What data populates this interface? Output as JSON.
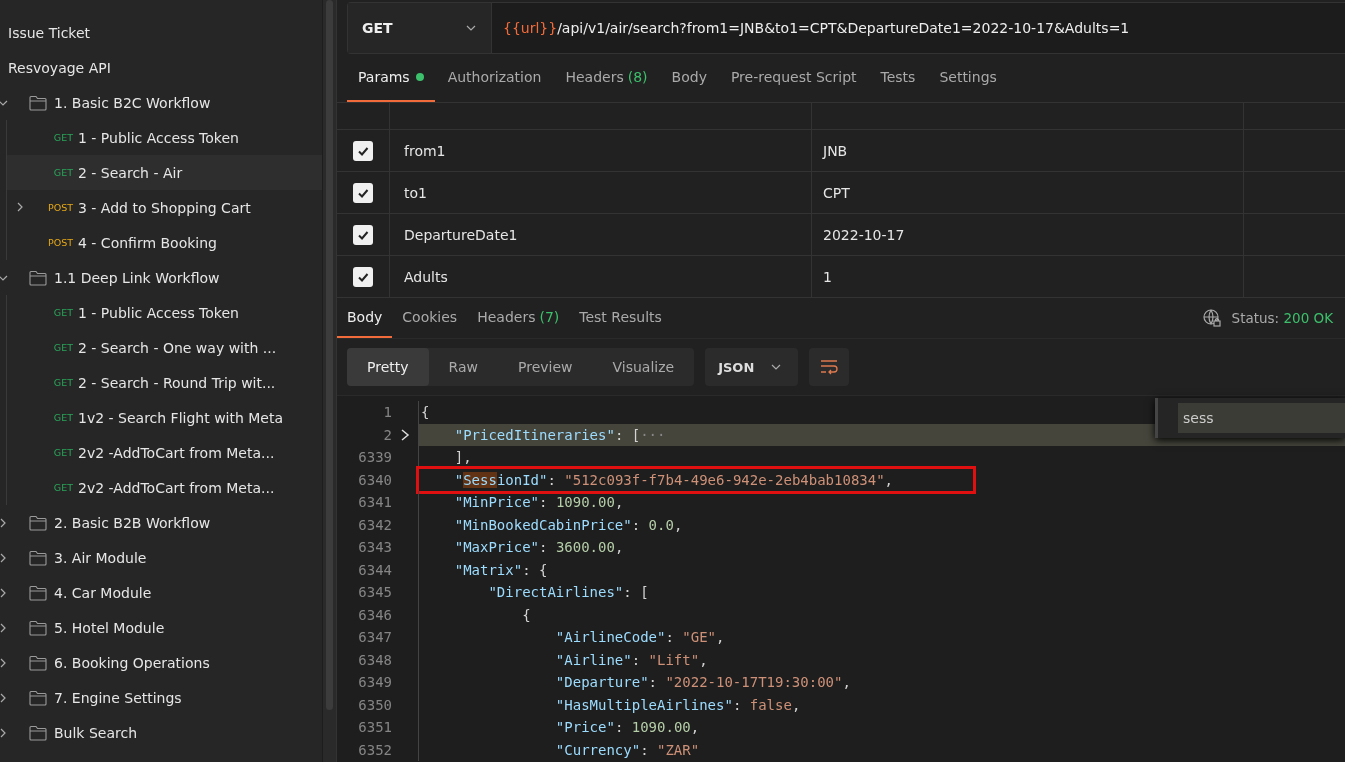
{
  "sidebar": {
    "items": [
      {
        "kind": "plain",
        "label": "Issue Ticket"
      },
      {
        "kind": "plain",
        "label": "Resvoyage API"
      },
      {
        "kind": "folder",
        "label": "1. Basic B2C Workflow",
        "expanded": true,
        "children": [
          {
            "kind": "request",
            "method": "GET",
            "label": "1 - Public Access Token",
            "selected": false,
            "expandable": false
          },
          {
            "kind": "request",
            "method": "GET",
            "label": "2 - Search - Air",
            "selected": true,
            "expandable": false
          },
          {
            "kind": "request",
            "method": "POST",
            "label": "3 - Add to Shopping Cart",
            "selected": false,
            "expandable": true
          },
          {
            "kind": "request",
            "method": "POST",
            "label": "4 - Confirm Booking",
            "selected": false,
            "expandable": false
          }
        ]
      },
      {
        "kind": "folder",
        "label": "1.1 Deep Link Workflow",
        "expanded": true,
        "children": [
          {
            "kind": "request",
            "method": "GET",
            "label": "1 - Public Access Token",
            "selected": false,
            "expandable": false
          },
          {
            "kind": "request",
            "method": "GET",
            "label": "2 - Search - One way with ...",
            "selected": false,
            "expandable": false
          },
          {
            "kind": "request",
            "method": "GET",
            "label": "2 - Search - Round Trip wit...",
            "selected": false,
            "expandable": false
          },
          {
            "kind": "request",
            "method": "GET",
            "label": "1v2 - Search Flight with Meta",
            "selected": false,
            "expandable": false
          },
          {
            "kind": "request",
            "method": "GET",
            "label": "2v2 -AddToCart from Meta...",
            "selected": false,
            "expandable": false
          },
          {
            "kind": "request",
            "method": "GET",
            "label": "2v2 -AddToCart from Meta...",
            "selected": false,
            "expandable": false
          }
        ]
      },
      {
        "kind": "folder",
        "label": "2. Basic B2B Workflow",
        "expanded": false
      },
      {
        "kind": "folder",
        "label": "3. Air Module",
        "expanded": false
      },
      {
        "kind": "folder",
        "label": "4. Car Module",
        "expanded": false
      },
      {
        "kind": "folder",
        "label": "5. Hotel Module",
        "expanded": false
      },
      {
        "kind": "folder",
        "label": "6. Booking Operations",
        "expanded": false
      },
      {
        "kind": "folder",
        "label": "7. Engine Settings",
        "expanded": false
      },
      {
        "kind": "folder",
        "label": "Bulk Search",
        "expanded": false
      }
    ]
  },
  "request": {
    "method": "GET",
    "url_variable": "{{url}}",
    "url_path": "/api/v1/air/search?from1=JNB&to1=CPT&DepartureDate1=2022-10-17&Adults=1"
  },
  "request_tabs": [
    {
      "label": "Params",
      "dot": true,
      "selected": true
    },
    {
      "label": "Authorization",
      "dot": false,
      "selected": false
    },
    {
      "label": "Headers",
      "count": "(8)",
      "dot": false,
      "selected": false
    },
    {
      "label": "Body",
      "dot": false,
      "selected": false
    },
    {
      "label": "Pre-request Script",
      "dot": false,
      "selected": false
    },
    {
      "label": "Tests",
      "dot": false,
      "selected": false
    },
    {
      "label": "Settings",
      "dot": false,
      "selected": false
    }
  ],
  "params": [
    {
      "checked": true,
      "key": "from1",
      "value": "JNB"
    },
    {
      "checked": true,
      "key": "to1",
      "value": "CPT"
    },
    {
      "checked": true,
      "key": "DepartureDate1",
      "value": "2022-10-17"
    },
    {
      "checked": true,
      "key": "Adults",
      "value": "1"
    }
  ],
  "response_tabs": [
    {
      "label": "Body",
      "selected": true
    },
    {
      "label": "Cookies",
      "selected": false
    },
    {
      "label": "Headers",
      "count": "(7)",
      "selected": false
    },
    {
      "label": "Test Results",
      "selected": false
    }
  ],
  "status": {
    "label": "Status:",
    "value": "200 OK"
  },
  "view_modes": [
    {
      "label": "Pretty",
      "selected": true
    },
    {
      "label": "Raw",
      "selected": false
    },
    {
      "label": "Preview",
      "selected": false
    },
    {
      "label": "Visualize",
      "selected": false
    }
  ],
  "format": "JSON",
  "find": {
    "value": "sess"
  },
  "code": [
    {
      "num": "1",
      "foldable": false,
      "current": false,
      "boxed": false,
      "parts": [
        {
          "kind": "punct",
          "text": "{"
        }
      ]
    },
    {
      "num": "2",
      "foldable": true,
      "current": true,
      "boxed": false,
      "parts": [
        {
          "kind": "key",
          "text": "    \"PricedItineraries\""
        },
        {
          "kind": "punct",
          "text": ": ["
        },
        {
          "kind": "fold",
          "text": "···"
        }
      ]
    },
    {
      "num": "6339",
      "foldable": false,
      "current": false,
      "boxed": false,
      "parts": [
        {
          "kind": "punct",
          "text": "    ],"
        }
      ]
    },
    {
      "num": "6340",
      "foldable": false,
      "current": false,
      "boxed": true,
      "parts": [
        {
          "kind": "key",
          "text": "    \""
        },
        {
          "kind": "match",
          "text": "Sess"
        },
        {
          "kind": "key",
          "text": "ionId\""
        },
        {
          "kind": "punct",
          "text": ": "
        },
        {
          "kind": "str",
          "text": "\"512c093f-f7b4-49e6-942e-2eb4bab10834\""
        },
        {
          "kind": "punct",
          "text": ","
        }
      ]
    },
    {
      "num": "6341",
      "foldable": false,
      "current": false,
      "boxed": false,
      "parts": [
        {
          "kind": "key",
          "text": "    \"MinPrice\""
        },
        {
          "kind": "punct",
          "text": ": "
        },
        {
          "kind": "num",
          "text": "1090.00"
        },
        {
          "kind": "punct",
          "text": ","
        }
      ]
    },
    {
      "num": "6342",
      "foldable": false,
      "current": false,
      "boxed": false,
      "parts": [
        {
          "kind": "key",
          "text": "    \"MinBookedCabinPrice\""
        },
        {
          "kind": "punct",
          "text": ": "
        },
        {
          "kind": "num",
          "text": "0.0"
        },
        {
          "kind": "punct",
          "text": ","
        }
      ]
    },
    {
      "num": "6343",
      "foldable": false,
      "current": false,
      "boxed": false,
      "parts": [
        {
          "kind": "key",
          "text": "    \"MaxPrice\""
        },
        {
          "kind": "punct",
          "text": ": "
        },
        {
          "kind": "num",
          "text": "3600.00"
        },
        {
          "kind": "punct",
          "text": ","
        }
      ]
    },
    {
      "num": "6344",
      "foldable": false,
      "current": false,
      "boxed": false,
      "parts": [
        {
          "kind": "key",
          "text": "    \"Matrix\""
        },
        {
          "kind": "punct",
          "text": ": {"
        }
      ]
    },
    {
      "num": "6345",
      "foldable": false,
      "current": false,
      "boxed": false,
      "parts": [
        {
          "kind": "key",
          "text": "        \"DirectAirlines\""
        },
        {
          "kind": "punct",
          "text": ": ["
        }
      ]
    },
    {
      "num": "6346",
      "foldable": false,
      "current": false,
      "boxed": false,
      "parts": [
        {
          "kind": "punct",
          "text": "            {"
        }
      ]
    },
    {
      "num": "6347",
      "foldable": false,
      "current": false,
      "boxed": false,
      "parts": [
        {
          "kind": "key",
          "text": "                \"AirlineCode\""
        },
        {
          "kind": "punct",
          "text": ": "
        },
        {
          "kind": "str",
          "text": "\"GE\""
        },
        {
          "kind": "punct",
          "text": ","
        }
      ]
    },
    {
      "num": "6348",
      "foldable": false,
      "current": false,
      "boxed": false,
      "parts": [
        {
          "kind": "key",
          "text": "                \"Airline\""
        },
        {
          "kind": "punct",
          "text": ": "
        },
        {
          "kind": "str",
          "text": "\"Lift\""
        },
        {
          "kind": "punct",
          "text": ","
        }
      ]
    },
    {
      "num": "6349",
      "foldable": false,
      "current": false,
      "boxed": false,
      "parts": [
        {
          "kind": "key",
          "text": "                \"Departure\""
        },
        {
          "kind": "punct",
          "text": ": "
        },
        {
          "kind": "str",
          "text": "\"2022-10-17T19:30:00\""
        },
        {
          "kind": "punct",
          "text": ","
        }
      ]
    },
    {
      "num": "6350",
      "foldable": false,
      "current": false,
      "boxed": false,
      "parts": [
        {
          "kind": "key",
          "text": "                \"HasMultipleAirlines\""
        },
        {
          "kind": "punct",
          "text": ": "
        },
        {
          "kind": "bool",
          "text": "false"
        },
        {
          "kind": "punct",
          "text": ","
        }
      ]
    },
    {
      "num": "6351",
      "foldable": false,
      "current": false,
      "boxed": false,
      "parts": [
        {
          "kind": "key",
          "text": "                \"Price\""
        },
        {
          "kind": "punct",
          "text": ": "
        },
        {
          "kind": "num",
          "text": "1090.00"
        },
        {
          "kind": "punct",
          "text": ","
        }
      ]
    },
    {
      "num": "6352",
      "foldable": false,
      "current": false,
      "boxed": false,
      "parts": [
        {
          "kind": "key",
          "text": "                \"Currency\""
        },
        {
          "kind": "punct",
          "text": ": "
        },
        {
          "kind": "str",
          "text": "\"ZAR\""
        }
      ]
    }
  ]
}
